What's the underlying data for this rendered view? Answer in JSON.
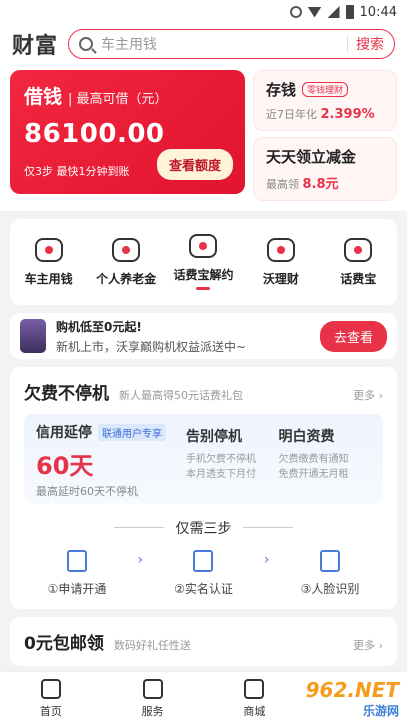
{
  "status": {
    "time": "10:44"
  },
  "header": {
    "title": "财富",
    "search_placeholder": "车主用钱",
    "search_button": "搜索"
  },
  "loan": {
    "label": "借钱",
    "sub": "最高可借（元）",
    "amount": "86100.00",
    "hint": "仅3步 最快1分钟到账",
    "button": "查看额度"
  },
  "savings": {
    "title": "存钱",
    "tag": "零钱理财",
    "desc": "近7日年化",
    "rate": "2.399%"
  },
  "cashback": {
    "title": "天天领立减金",
    "desc": "最高领",
    "amount": "8.8元"
  },
  "shortcuts": [
    {
      "label": "车主用钱",
      "icon": "car-icon"
    },
    {
      "label": "个人养老金",
      "icon": "pension-icon"
    },
    {
      "label": "话费宝解约",
      "icon": "phonebill-icon"
    },
    {
      "label": "沃理财",
      "icon": "wealth-icon"
    },
    {
      "label": "话费宝",
      "icon": "phonebill-icon"
    }
  ],
  "promo": {
    "title": "购机低至0元起!",
    "subtitle": "新机上市，沃享巅购机权益派送中~",
    "button": "去查看"
  },
  "arrears": {
    "title": "欠费不停机",
    "subtitle": "新人最高得50元话费礼包",
    "more": "更多",
    "credit": {
      "title": "信用延停",
      "badge": "联通用户专享",
      "days": "60天",
      "caption": "最高延时60天不停机"
    },
    "stop": {
      "title": "告别停机",
      "lines": [
        "手机欠费不停机",
        "本月透支下月付"
      ]
    },
    "clear": {
      "title": "明白资费",
      "lines": [
        "欠费缴费有通知",
        "免费开通无月租"
      ]
    },
    "steps_title": "仅需三步",
    "steps": [
      "①申请开通",
      "②实名认证",
      "③人脸识别"
    ]
  },
  "free_mail": {
    "title": "0元包邮领",
    "subtitle": "数码好礼任性送",
    "more": "更多"
  },
  "tabs": [
    {
      "label": "首页",
      "icon": "home-icon"
    },
    {
      "label": "服务",
      "icon": "grid-icon"
    },
    {
      "label": "商城",
      "icon": "bag-icon"
    }
  ],
  "watermark": {
    "brand": "962.NET",
    "sub": "乐游网"
  }
}
